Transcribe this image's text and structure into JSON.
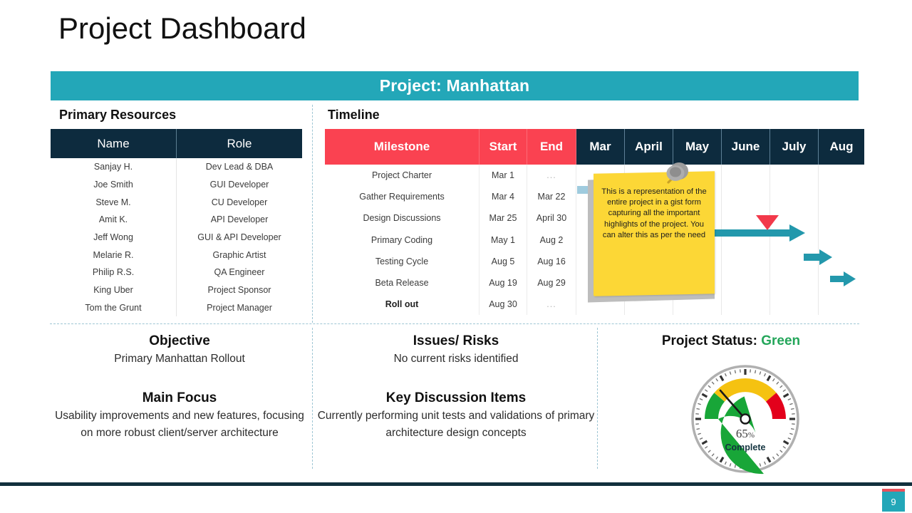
{
  "page": {
    "title": "Project Dashboard",
    "number": "9"
  },
  "banner": {
    "label": "Project: Manhattan"
  },
  "resources": {
    "heading": "Primary Resources",
    "columns": [
      "Name",
      "Role"
    ],
    "rows": [
      {
        "name": "Sanjay H.",
        "role": "Dev Lead & DBA"
      },
      {
        "name": "Joe Smith",
        "role": "GUI Developer"
      },
      {
        "name": "Steve M.",
        "role": "CU Developer"
      },
      {
        "name": "Amit K.",
        "role": "API Developer"
      },
      {
        "name": "Jeff Wong",
        "role": "GUI & API Developer"
      },
      {
        "name": "Melarie R.",
        "role": "Graphic Artist"
      },
      {
        "name": "Philip R.S.",
        "role": "QA Engineer"
      },
      {
        "name": "King Uber",
        "role": "Project Sponsor"
      },
      {
        "name": "Tom the Grunt",
        "role": "Project Manager"
      }
    ]
  },
  "timeline": {
    "heading": "Timeline",
    "columns": {
      "milestone": "Milestone",
      "start": "Start",
      "end": "End",
      "months": [
        "Mar",
        "April",
        "May",
        "June",
        "July",
        "Aug"
      ]
    },
    "rows": [
      {
        "milestone": "Project Charter",
        "start": "Mar 1",
        "end": "..."
      },
      {
        "milestone": "Gather Requirements",
        "start": "Mar 4",
        "end": "Mar 22"
      },
      {
        "milestone": "Design Discussions",
        "start": "Mar 25",
        "end": "April 30"
      },
      {
        "milestone": "Primary Coding",
        "start": "May 1",
        "end": "Aug 2"
      },
      {
        "milestone": "Testing Cycle",
        "start": "Aug 5",
        "end": "Aug 16"
      },
      {
        "milestone": "Beta Release",
        "start": "Aug 19",
        "end": "Aug 29"
      },
      {
        "milestone": "Roll out",
        "start": "Aug 30",
        "end": "..."
      }
    ],
    "sticky_note": {
      "text": "This is a representation of the entire project in a gist form capturing all the important highlights of the project. You can alter this as per the need"
    }
  },
  "objective": {
    "title": "Objective",
    "body": "Primary Manhattan Rollout",
    "focus_title": "Main Focus",
    "focus_body": "Usability improvements and new features, focusing on more robust client/server architecture"
  },
  "issues": {
    "title": "Issues/ Risks",
    "body": "No current risks identified",
    "discussion_title": "Key Discussion Items",
    "discussion_body": "Currently performing unit tests and validations of primary architecture design concepts"
  },
  "status": {
    "label": "Project Status:",
    "value": "Green",
    "gauge_percent": "65",
    "gauge_percent_sign": "%",
    "gauge_caption": "Complete"
  },
  "colors": {
    "teal": "#23A7B8",
    "navy": "#0D2B3E",
    "red": "#FA4251",
    "green": "#24A65A",
    "gauge_green": "#18A638",
    "gauge_yellow": "#F5C211",
    "gauge_red": "#E3001B",
    "sticky_yellow": "#FCD736"
  }
}
